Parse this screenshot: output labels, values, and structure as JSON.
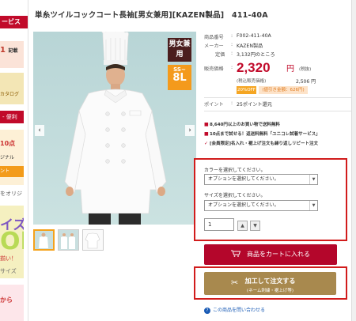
{
  "sidebar": {
    "service_label": "ービス",
    "banner1_text": "1",
    "banner1_sub": "記載",
    "banner2_text": "カタログ",
    "banner3_text": "- 便利",
    "banner4_t1": "10点",
    "banner4_t2": "ジナル",
    "banner4_t3": "ント",
    "text1": "をオリジ",
    "banner5_t1": "イズ",
    "banner5_t2": "OL",
    "banner5_t3": "揃い！",
    "banner5_t4": "サイズ",
    "banner6_t1": "から"
  },
  "product": {
    "title": "単糸ツイルコックコート長袖[男女兼用][KAZEN製品]　411-40A",
    "badge_gender": "男女兼用",
    "badge_size_top": "SS~",
    "badge_size_bottom": "8L",
    "arrow_left": "‹",
    "arrow_right": "›"
  },
  "thumbnails": [
    "thumb-1",
    "thumb-2",
    "thumb-3"
  ],
  "details": {
    "item_no_label": "商品番号",
    "item_no_value": "F002-411-40A",
    "maker_label": "メーカー",
    "maker_value": "KAZEN製品",
    "list_price_label": "定価",
    "list_price_value": "3,132円のところ",
    "sale_label": "販売価格",
    "price": "2,320",
    "yen": "円",
    "tax_note": "(税抜)",
    "tax_incl_label": "(税込販売価格)",
    "tax_incl_value": "2,506 円",
    "discount": "20%OFF",
    "discount_amount": "(値引き金額：626円)",
    "point_label": "ポイント",
    "point_value": "25ポイント還元",
    "sep": ":"
  },
  "notices": [
    "8,640円以上のお買い物で送料無料",
    "10点まで試せる！返送料無料「ユニコレ試着サービス」",
    "[会員限定]名入れ・裾上げ注文も繰り返しリピート注文"
  ],
  "options": {
    "color_label": "カラーを選択してください。",
    "color_select": "オプションを選択してください。",
    "size_label": "サイズを選択してください。",
    "size_select": "オプションを選択してください。",
    "qty": "1",
    "qty_up": "▲",
    "qty_down": "▼",
    "dd": "▼"
  },
  "buttons": {
    "cart": "商品をカートに入れる",
    "custom_l1": "加工して注文する",
    "custom_l2": "(ネーム刺繍・裾上げ等)",
    "inquiry": "この商品を問い合わせる"
  },
  "colors": {
    "accent_red": "#c10a2a",
    "gold": "#a8894e",
    "highlight_border": "#d11c1c"
  }
}
